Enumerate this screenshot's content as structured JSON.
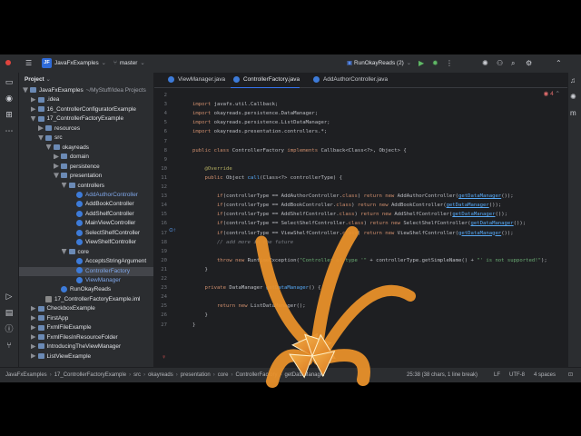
{
  "titlebar": {
    "project_badge": "JF",
    "project_name": "JavaFxExamples",
    "branch": "master",
    "run_config": "RunOkayReads (2)"
  },
  "sidebar": {
    "header": "Project",
    "tree": [
      {
        "label": "JavaFxExamples",
        "suffix": "~/MyStuff/Idea Projects",
        "type": "module",
        "depth": 0,
        "open": true
      },
      {
        "label": ".idea",
        "type": "folder",
        "depth": 1,
        "open": false
      },
      {
        "label": "16_ControllerConfiguratorExample",
        "type": "module",
        "depth": 1,
        "open": false
      },
      {
        "label": "17_ControllerFactoryExample",
        "type": "module",
        "depth": 1,
        "open": true
      },
      {
        "label": "resources",
        "type": "folder",
        "depth": 2,
        "open": false
      },
      {
        "label": "src",
        "type": "folder",
        "depth": 2,
        "open": true
      },
      {
        "label": "okayreads",
        "type": "folder",
        "depth": 3,
        "open": true
      },
      {
        "label": "domain",
        "type": "folder",
        "depth": 4,
        "open": false
      },
      {
        "label": "persistence",
        "type": "folder",
        "depth": 4,
        "open": false
      },
      {
        "label": "presentation",
        "type": "folder",
        "depth": 4,
        "open": true
      },
      {
        "label": "controllers",
        "type": "folder",
        "depth": 5,
        "open": true
      },
      {
        "label": "AddAuthorController",
        "type": "class",
        "depth": 6,
        "color": "blue"
      },
      {
        "label": "AddBookController",
        "type": "class",
        "depth": 6
      },
      {
        "label": "AddShelfController",
        "type": "class",
        "depth": 6
      },
      {
        "label": "MainViewController",
        "type": "class",
        "depth": 6
      },
      {
        "label": "SelectShelfController",
        "type": "class",
        "depth": 6
      },
      {
        "label": "ViewShelfController",
        "type": "class",
        "depth": 6
      },
      {
        "label": "core",
        "type": "folder",
        "depth": 5,
        "open": true
      },
      {
        "label": "AcceptsStringArgument",
        "type": "class",
        "depth": 6
      },
      {
        "label": "ControllerFactory",
        "type": "class",
        "depth": 6,
        "selected": true,
        "color": "blue"
      },
      {
        "label": "ViewManager",
        "type": "class",
        "depth": 6,
        "color": "blue"
      },
      {
        "label": "RunOkayReads",
        "type": "class",
        "depth": 4
      },
      {
        "label": "17_ControllerFactoryExample.iml",
        "type": "iml",
        "depth": 2
      },
      {
        "label": "CheckboxExample",
        "type": "module",
        "depth": 1,
        "open": false
      },
      {
        "label": "FirstApp",
        "type": "module",
        "depth": 1,
        "open": false
      },
      {
        "label": "FxmlFileExample",
        "type": "module",
        "depth": 1,
        "open": false
      },
      {
        "label": "FxmlFilesInResourceFolder",
        "type": "module",
        "depth": 1,
        "open": false
      },
      {
        "label": "IntroducingTheViewManager",
        "type": "module",
        "depth": 1,
        "open": false
      },
      {
        "label": "ListViewExample",
        "type": "module",
        "depth": 1,
        "open": false
      }
    ]
  },
  "tabs": [
    {
      "label": "ViewManager.java",
      "active": false
    },
    {
      "label": "ControllerFactory.java",
      "active": true
    },
    {
      "label": "AddAuthorController.java",
      "active": false
    }
  ],
  "editor": {
    "error_count": "4",
    "line_numbers": [
      "2",
      "3",
      "4",
      "5",
      "6",
      "7",
      "8",
      "9",
      "10",
      "11",
      "12",
      "13",
      "14",
      "15",
      "16",
      "17",
      "18",
      "19",
      "20",
      "21",
      "22",
      "23",
      "24",
      "25",
      "26",
      "27"
    ],
    "lines": [
      [],
      [
        {
          "t": "import ",
          "c": "kw"
        },
        {
          "t": "javafx.util.Callback;",
          "c": "ty"
        }
      ],
      [
        {
          "t": "import ",
          "c": "kw"
        },
        {
          "t": "okayreads.persistence.DataManager;",
          "c": "ty"
        }
      ],
      [
        {
          "t": "import ",
          "c": "kw"
        },
        {
          "t": "okayreads.persistence.ListDataManager;",
          "c": "ty"
        }
      ],
      [
        {
          "t": "import ",
          "c": "kw"
        },
        {
          "t": "okayreads.presentation.controllers.*;",
          "c": "ty"
        }
      ],
      [],
      [
        {
          "t": "public class ",
          "c": "kw"
        },
        {
          "t": "ControllerFactory ",
          "c": "ty"
        },
        {
          "t": "implements ",
          "c": "kw"
        },
        {
          "t": "Callback<Class<?>, Object> {",
          "c": "ty"
        }
      ],
      [],
      [
        {
          "t": "    @Override",
          "c": "an"
        }
      ],
      [
        {
          "t": "    public ",
          "c": "kw"
        },
        {
          "t": "Object ",
          "c": "ty"
        },
        {
          "t": "call",
          "c": "fn"
        },
        {
          "t": "(Class<?> controllerType) {",
          "c": "ty"
        }
      ],
      [],
      [
        {
          "t": "        if",
          "c": "kw"
        },
        {
          "t": "(controllerType == AddAuthorController.",
          "c": "ty"
        },
        {
          "t": "class",
          "c": "kw"
        },
        {
          "t": ") ",
          "c": "ty"
        },
        {
          "t": "return new ",
          "c": "kw"
        },
        {
          "t": "AddAuthorController(",
          "c": "ty"
        },
        {
          "t": "getDataManager",
          "c": "ul"
        },
        {
          "t": "());",
          "c": "ty"
        }
      ],
      [
        {
          "t": "        if",
          "c": "kw"
        },
        {
          "t": "(controllerType == AddBookController.",
          "c": "ty"
        },
        {
          "t": "class",
          "c": "kw"
        },
        {
          "t": ") ",
          "c": "ty"
        },
        {
          "t": "return new ",
          "c": "kw"
        },
        {
          "t": "AddBookController(",
          "c": "ty"
        },
        {
          "t": "getDataManager",
          "c": "ul"
        },
        {
          "t": "());",
          "c": "ty"
        }
      ],
      [
        {
          "t": "        if",
          "c": "kw"
        },
        {
          "t": "(controllerType == AddShelfController.",
          "c": "ty"
        },
        {
          "t": "class",
          "c": "kw"
        },
        {
          "t": ") ",
          "c": "ty"
        },
        {
          "t": "return new ",
          "c": "kw"
        },
        {
          "t": "AddShelfController(",
          "c": "ty"
        },
        {
          "t": "getDataManager",
          "c": "ul"
        },
        {
          "t": "());",
          "c": "ty"
        }
      ],
      [
        {
          "t": "        if",
          "c": "kw"
        },
        {
          "t": "(controllerType == SelectShelfController.",
          "c": "ty"
        },
        {
          "t": "class",
          "c": "kw"
        },
        {
          "t": ") ",
          "c": "ty"
        },
        {
          "t": "return new ",
          "c": "kw"
        },
        {
          "t": "SelectShelfController(",
          "c": "ty"
        },
        {
          "t": "getDataManager",
          "c": "ul"
        },
        {
          "t": "());",
          "c": "ty"
        }
      ],
      [
        {
          "t": "        if",
          "c": "kw"
        },
        {
          "t": "(controllerType == ViewShelfController.",
          "c": "ty"
        },
        {
          "t": "class",
          "c": "kw"
        },
        {
          "t": ") ",
          "c": "ty"
        },
        {
          "t": "return new ",
          "c": "kw"
        },
        {
          "t": "ViewShelfController(",
          "c": "ty"
        },
        {
          "t": "getDataManager",
          "c": "ul"
        },
        {
          "t": "());",
          "c": "ty"
        }
      ],
      [
        {
          "t": "        // add more in the future",
          "c": "cm"
        }
      ],
      [],
      [
        {
          "t": "        throw new ",
          "c": "kw"
        },
        {
          "t": "RuntimeException(",
          "c": "ty"
        },
        {
          "t": "\"Controller of type '\"",
          "c": "st"
        },
        {
          "t": " + controllerType.getSimpleName() + ",
          "c": "ty"
        },
        {
          "t": "\"' is not supported!\"",
          "c": "st"
        },
        {
          "t": ");",
          "c": "ty"
        }
      ],
      [
        {
          "t": "    }",
          "c": "ty"
        }
      ],
      [],
      [
        {
          "t": "    private ",
          "c": "kw"
        },
        {
          "t": "DataManager ",
          "c": "ty"
        },
        {
          "t": "getDataManager",
          "c": "fn"
        },
        {
          "t": "() {",
          "c": "ty"
        }
      ],
      [],
      [
        {
          "t": "        return new ",
          "c": "kw"
        },
        {
          "t": "ListDataManager();",
          "c": "ty"
        }
      ],
      [
        {
          "t": "    }",
          "c": "ty"
        }
      ],
      [
        {
          "t": "}",
          "c": "ty"
        }
      ]
    ]
  },
  "statusbar": {
    "breadcrumbs": [
      "JavaFxExamples",
      "17_ControllerFactoryExample",
      "src",
      "okayreads",
      "presentation",
      "core",
      "ControllerFactory",
      "getDataManager"
    ],
    "position": "25:38 (38 chars, 1 line break)",
    "line_sep": "LF",
    "encoding": "UTF-8",
    "indent": "4 spaces"
  },
  "colors": {
    "arrow_fill": "#e8902a",
    "arrow_edge": "#fff0c8",
    "accent": "#3574f0"
  }
}
